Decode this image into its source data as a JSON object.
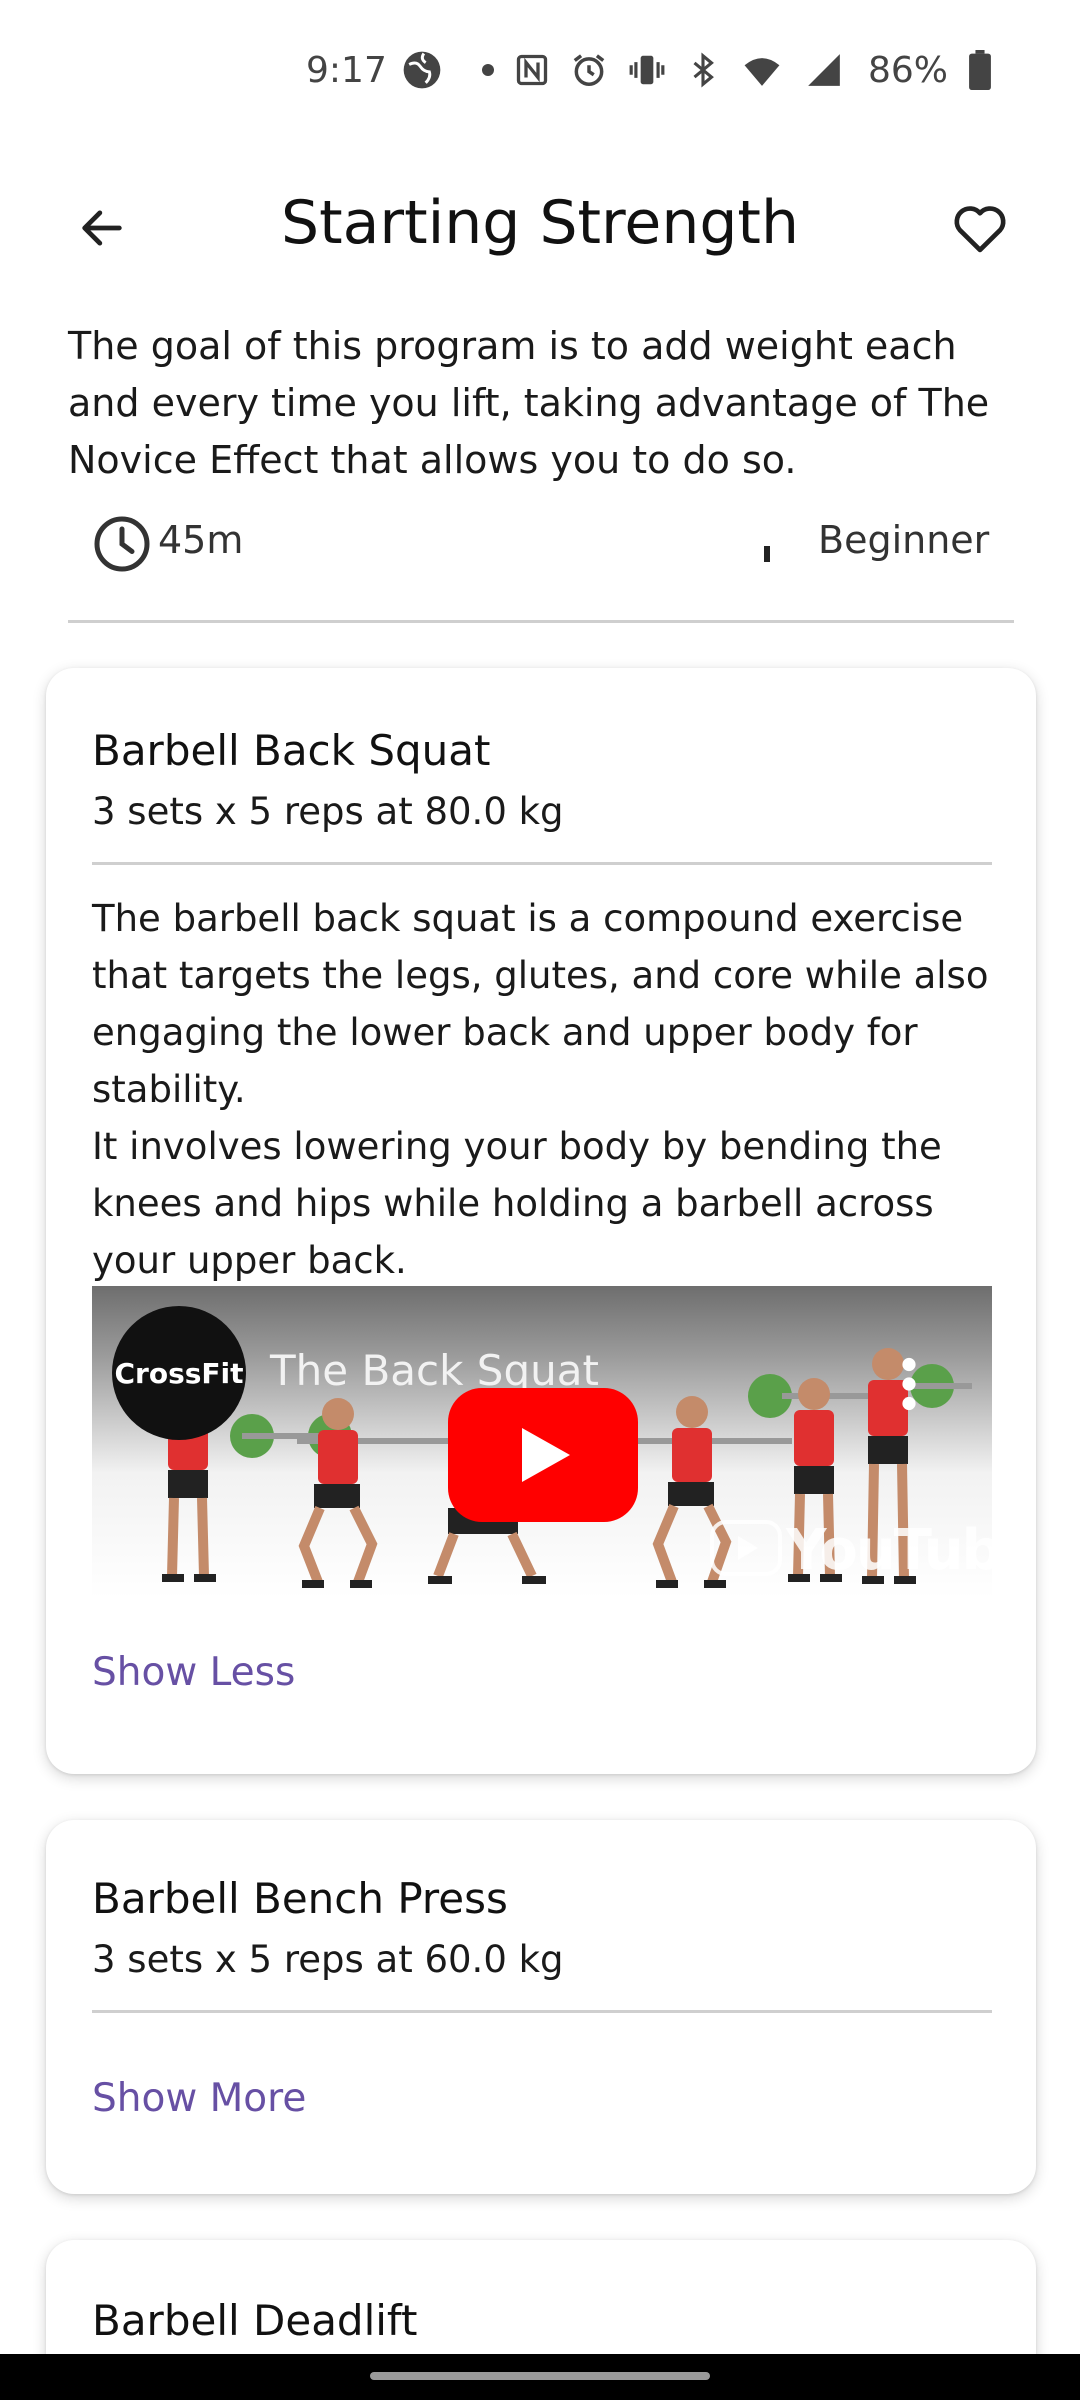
{
  "status_bar": {
    "time": "9:17",
    "battery": "86%"
  },
  "app_bar": {
    "title": "Starting Strength"
  },
  "program": {
    "description": "The goal of this program is to add weight each and every time you lift, taking advantage of The Novice Effect that allows you to do so.",
    "duration": "45m",
    "level": "Beginner"
  },
  "exercises": [
    {
      "name": "Barbell Back Squat",
      "sets": "3 sets x 5 reps at 80.0 kg",
      "description": "The barbell back squat is a compound exercise that targets the legs, glutes, and core while also engaging the lower back and upper body for stability.\nIt involves lowering your body by bending the knees and hips while holding a barbell across your upper back.",
      "video": {
        "title": "The Back Squat",
        "channel": "CrossFit",
        "brand": "YouTube"
      },
      "toggle": "Show Less"
    },
    {
      "name": "Barbell Bench Press",
      "sets": "3 sets x 5 reps at 60.0 kg",
      "toggle": "Show More"
    },
    {
      "name": "Barbell Deadlift"
    }
  ],
  "colors": {
    "accent": "#6750a4",
    "youtube_red": "#ff0000",
    "divider": "#cfcfcf"
  }
}
